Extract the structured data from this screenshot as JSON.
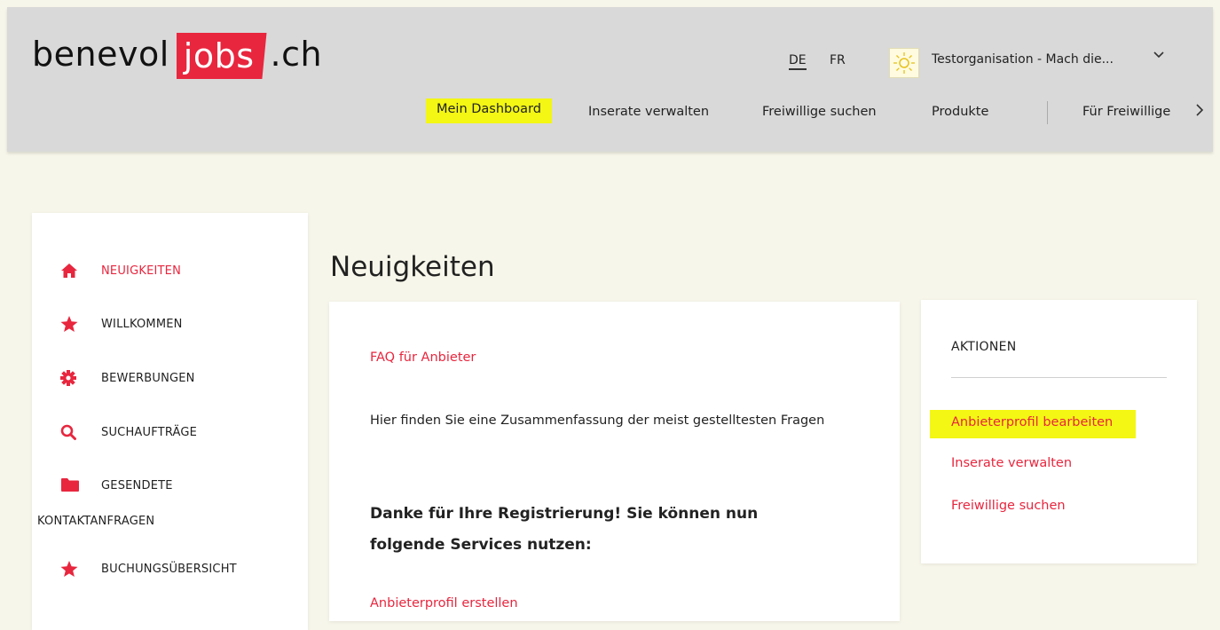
{
  "header": {
    "logo": {
      "part1": "benevol",
      "part2": "jobs",
      "part3": ".ch"
    },
    "languages": [
      "DE",
      "FR"
    ],
    "org_name": "Testorganisation - Mach die...",
    "nav": [
      "Mein Dashboard",
      "Inserate verwalten",
      "Freiwillige suchen",
      "Produkte",
      "Für Freiwillige"
    ]
  },
  "sidebar": {
    "items": [
      {
        "label": "NEUIGKEITEN",
        "icon": "home-icon"
      },
      {
        "label": "WILLKOMMEN",
        "icon": "star-icon"
      },
      {
        "label": "BEWERBUNGEN",
        "icon": "gear-icon"
      },
      {
        "label": "SUCHAUFTRÄGE",
        "icon": "search-icon"
      },
      {
        "label": "GESENDETE",
        "label2": "KONTAKTANFRAGEN",
        "icon": "folder-icon"
      },
      {
        "label": "BUCHUNGSÜBERSICHT",
        "icon": "star-icon"
      }
    ]
  },
  "main": {
    "title": "Neuigkeiten",
    "faq_link": "FAQ für Anbieter",
    "faq_text": "Hier finden Sie eine Zusammenfassung der meist gestelltesten Fragen",
    "thanks_text": "Danke für Ihre Registrierung! Sie können nun folgende Services nutzen:",
    "create_profile_link": "Anbieterprofil erstellen"
  },
  "actions": {
    "heading": "AKTIONEN",
    "items": [
      "Anbieterprofil bearbeiten",
      "Inserate verwalten",
      "Freiwillige suchen"
    ]
  },
  "colors": {
    "accent": "#e8263e",
    "highlight": "#f3f713",
    "header_bg": "#d9d9d9",
    "page_bg": "#f7f6ea"
  }
}
